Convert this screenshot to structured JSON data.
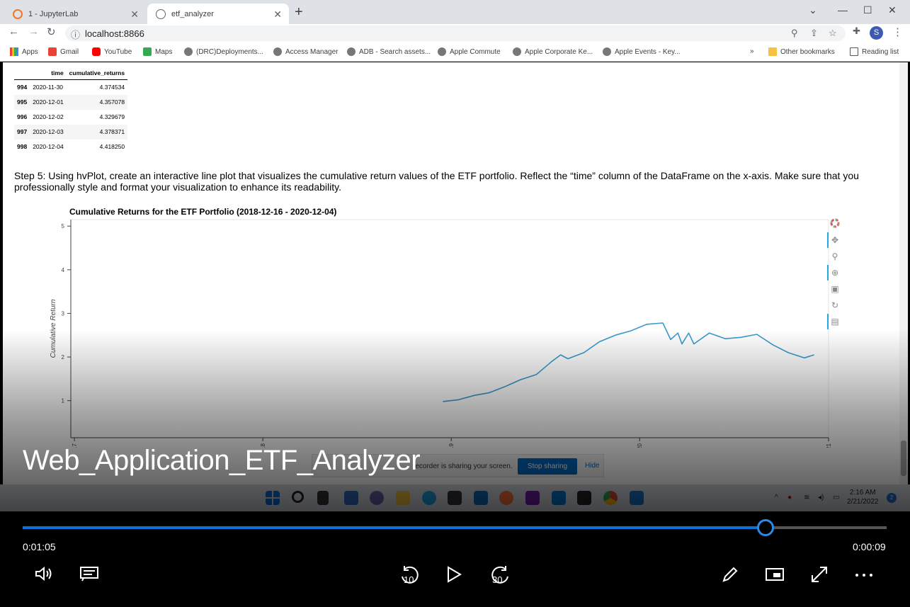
{
  "browser": {
    "tabs": [
      {
        "label": "1 - JupyterLab",
        "active": false
      },
      {
        "label": "etf_analyzer",
        "active": true
      }
    ],
    "url": "localhost:8866",
    "profile_initial": "S",
    "bookmarks": [
      "Apps",
      "Gmail",
      "YouTube",
      "Maps",
      "(DRC)Deployments...",
      "Access Manager",
      "ADB - Search assets...",
      "Apple Commute",
      "Apple Corporate Ke...",
      "Apple Events - Key..."
    ],
    "other_bookmarks": "Other bookmarks",
    "reading_list": "Reading list",
    "more_bookmarks": "»"
  },
  "dataframe": {
    "columns": [
      "time",
      "cumulative_returns"
    ],
    "rows": [
      {
        "index": "994",
        "time": "2020-11-30",
        "value": "4.374534"
      },
      {
        "index": "995",
        "time": "2020-12-01",
        "value": "4.357078"
      },
      {
        "index": "996",
        "time": "2020-12-02",
        "value": "4.329679"
      },
      {
        "index": "997",
        "time": "2020-12-03",
        "value": "4.378371"
      },
      {
        "index": "998",
        "time": "2020-12-04",
        "value": "4.418250"
      }
    ]
  },
  "step_text": "Step 5: Using hvPlot, create an interactive line plot that visualizes the cumulative return values of the ETF portfolio. Reflect the “time” column of the DataFrame on the x-axis. Make sure that you professionally style and format your visualization to enhance its readability.",
  "chart_data": {
    "type": "line",
    "title": "Cumulative Returns for the ETF Portfolio (2018-12-16 - 2020-12-04)",
    "xlabel": "",
    "ylabel": "Cumulative Return",
    "x_tick_labels": [
      "017",
      "018",
      "019",
      "2020",
      "2021"
    ],
    "y_ticks": [
      1,
      2,
      3,
      4,
      5
    ],
    "ylim": [
      0.15,
      5.15
    ],
    "grid": false,
    "series_color": "#3a9bd0",
    "series": [
      {
        "name": "",
        "x": [
          "2018-12-16",
          "2019-01-15",
          "2019-02-15",
          "2019-03-15",
          "2019-04-15",
          "2019-05-15",
          "2019-06-15",
          "2019-07-15",
          "2019-08-01",
          "2019-08-15",
          "2019-09-15",
          "2019-10-15",
          "2019-11-15",
          "2019-12-15",
          "2020-01-15",
          "2020-02-15",
          "2020-03-01",
          "2020-03-15",
          "2020-03-23",
          "2020-04-05",
          "2020-04-15",
          "2020-05-15",
          "2020-06-15",
          "2020-07-15",
          "2020-08-15",
          "2020-09-15",
          "2020-10-15",
          "2020-11-15",
          "2020-12-04"
        ],
        "y": [
          0.98,
          1.02,
          1.12,
          1.18,
          1.32,
          1.48,
          1.6,
          1.9,
          2.05,
          1.96,
          2.1,
          2.35,
          2.5,
          2.6,
          2.75,
          2.78,
          2.4,
          2.55,
          2.3,
          2.55,
          2.3,
          2.55,
          2.42,
          2.45,
          2.52,
          2.28,
          2.1,
          1.98,
          2.05
        ]
      }
    ],
    "tools": [
      "bokeh-logo-icon",
      "pan-icon",
      "box-zoom-icon",
      "wheel-zoom-icon",
      "save-icon",
      "reset-icon",
      "hover-icon"
    ]
  },
  "share_banner": {
    "text": "recorder is sharing your screen.",
    "stop_label": "Stop sharing",
    "hide_label": "Hide"
  },
  "taskbar": {
    "time": "2:16 AM",
    "date": "2/21/2022",
    "notifications": "2"
  },
  "video": {
    "title": "Web_Application_ETF_Analyzer",
    "elapsed": "0:01:05",
    "remaining": "0:00:09",
    "progress": 0.86,
    "rewind_label": "10",
    "forward_label": "30"
  }
}
